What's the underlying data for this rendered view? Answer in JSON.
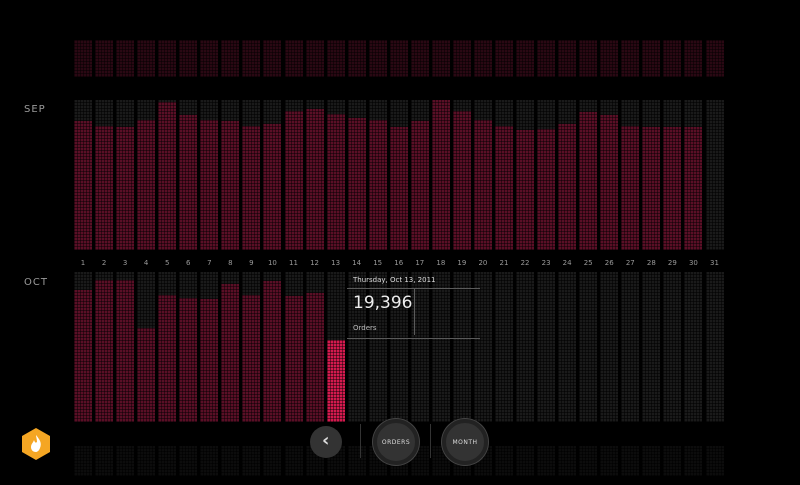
{
  "months": {
    "sep": "SEP",
    "oct": "OCT"
  },
  "days": [
    "1",
    "2",
    "3",
    "4",
    "5",
    "6",
    "7",
    "8",
    "9",
    "10",
    "11",
    "12",
    "13",
    "14",
    "15",
    "16",
    "17",
    "18",
    "19",
    "20",
    "21",
    "22",
    "23",
    "24",
    "25",
    "26",
    "27",
    "28",
    "29",
    "30",
    "31"
  ],
  "sep_levels": [
    0.86,
    0.83,
    0.82,
    0.87,
    0.99,
    0.9,
    0.87,
    0.86,
    0.83,
    0.84,
    0.93,
    0.94,
    0.91,
    0.88,
    0.87,
    0.82,
    0.86,
    1.0,
    0.93,
    0.87,
    0.83,
    0.8,
    0.81,
    0.84,
    0.92,
    0.9,
    0.83,
    0.82,
    0.82,
    0.82,
    0
  ],
  "oct_levels": [
    0.88,
    0.95,
    0.95,
    0.63,
    0.85,
    0.83,
    0.82,
    0.92,
    0.85,
    0.94,
    0.84,
    0.86,
    0.55,
    0,
    0,
    0,
    0,
    0,
    0,
    0,
    0,
    0,
    0,
    0,
    0,
    0,
    0,
    0,
    0,
    0,
    0
  ],
  "selected_day_index": 12,
  "tooltip": {
    "date": "Thursday, Oct 13, 2011",
    "value": "19,396",
    "unit": "Orders"
  },
  "controls": {
    "back_label": "‹",
    "metric_label": "ORDERS",
    "period_label": "MONTH"
  },
  "colors": {
    "accent": "#d41a4e",
    "fill": "#5a0f26",
    "logo": "#f5a623"
  }
}
